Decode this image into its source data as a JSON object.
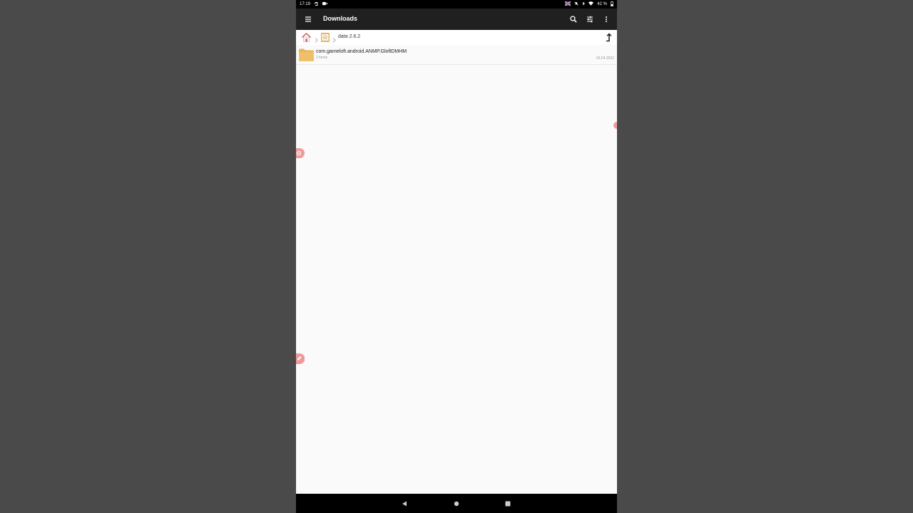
{
  "status_bar": {
    "time": "17:19",
    "battery": "42 %",
    "left_icons": [
      "sync-icon",
      "video-icon"
    ],
    "right_icons": [
      "flag-icon",
      "mute-icon",
      "bluetooth-icon",
      "wifi-icon",
      "battery-icon"
    ]
  },
  "app_bar": {
    "title": "Downloads",
    "actions": [
      "search-icon",
      "filter-icon",
      "more-icon"
    ]
  },
  "breadcrumb": {
    "current": "data 2.6.2"
  },
  "files": [
    {
      "name": "com.gameloft.android.ANMP.GloftDMHM",
      "meta": "2 items",
      "date": "03.04.2022",
      "icon": "folder-icon"
    }
  ],
  "colors": {
    "app_bar": "#202020",
    "background": "#fafafa",
    "folder": "#e8b45c",
    "accent": "#e57373"
  }
}
